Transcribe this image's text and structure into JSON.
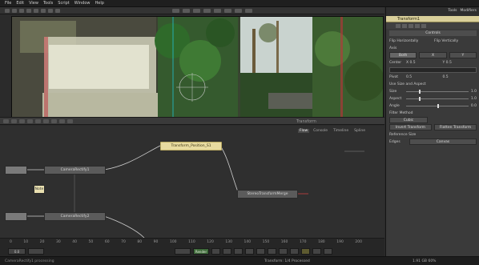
{
  "menubar": {
    "items": [
      "File",
      "Edit",
      "View",
      "Tools",
      "Script",
      "Window",
      "Help"
    ]
  },
  "viewer": {
    "label": "Transform"
  },
  "flow": {
    "tabs": [
      "Flow",
      "Console",
      "Timeline",
      "Spline"
    ],
    "nodes": {
      "left1": "",
      "left2": "",
      "camera1": "CameraRectify1",
      "camera2": "CameraRectify2",
      "selected": "Transform_Position_S1",
      "merge": "StereoTransformMerge",
      "note": "Note"
    }
  },
  "timeline": {
    "ticks": [
      "0",
      "10",
      "20",
      "30",
      "40",
      "50",
      "60",
      "70",
      "80",
      "90",
      "100",
      "110",
      "120",
      "130",
      "140",
      "150",
      "160",
      "170",
      "180",
      "190",
      "200"
    ],
    "render_label": "Render",
    "frame_value": "0.0"
  },
  "status": {
    "left": "CameraRectify1 processing",
    "mid": "Transform: 1/4 Processed",
    "right": "1.91 GB  60%"
  },
  "inspector": {
    "tabs": [
      "Tools",
      "Modifiers"
    ],
    "node_title": "Transform1",
    "section": "Controls",
    "flip_h": "Flip Horizontally",
    "flip_v": "Flip Vertically",
    "axis_label": "Axis",
    "axis_a": "Both",
    "axis_b": "X",
    "axis_c": "Y",
    "center_label": "Center",
    "center_x": "X 0.5",
    "center_y": "Y 0.5",
    "pivot_label": "Pivot",
    "pivot_x": "0.5",
    "pivot_y": "0.5",
    "size_check": "Use Size and Aspect",
    "size_label": "Size",
    "size_value": "1.0",
    "aspect_label": "Aspect",
    "aspect_value": "1.0",
    "angle_label": "Angle",
    "angle_value": "0.0",
    "filter_label": "Filter Method",
    "filter_value": "Cubic",
    "invert_btn": "Invert Transform",
    "flatten_btn": "Flatten Transform",
    "reference_label": "Reference Size",
    "edges_label": "Edges",
    "edges_value": "Canvas"
  }
}
